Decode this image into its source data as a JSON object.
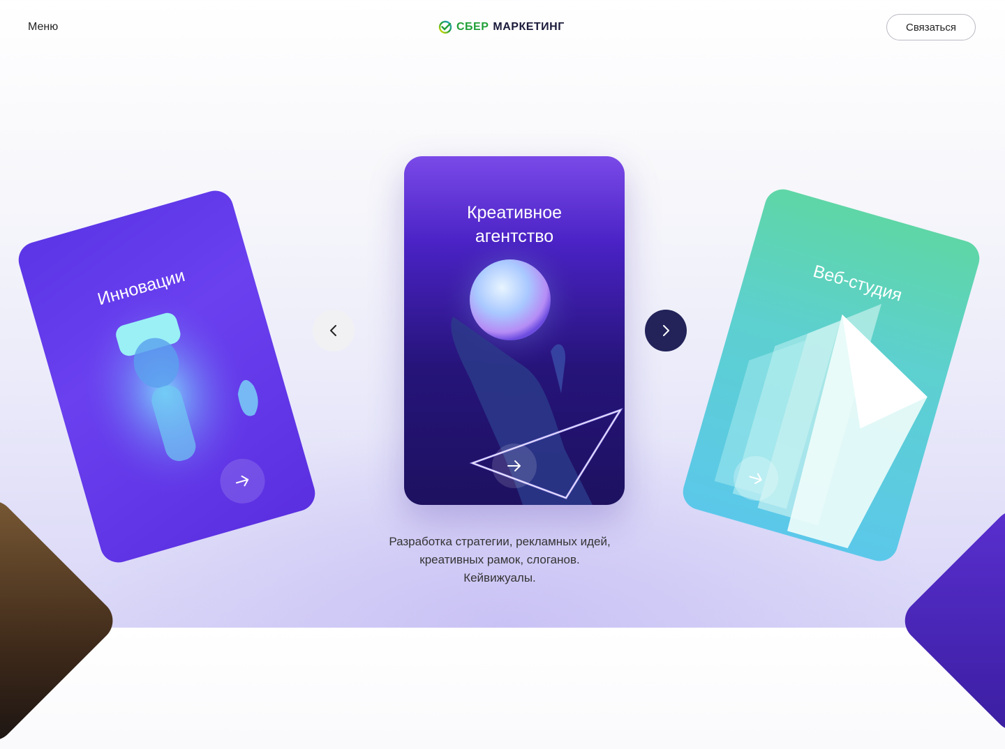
{
  "header": {
    "menu_label": "Меню",
    "logo_sber": "СБЕР",
    "logo_marketing": "МАРКЕТИНГ",
    "contact_label": "Связаться"
  },
  "cards": {
    "left": {
      "title": "Инновации"
    },
    "center": {
      "title_line1": "Креативное",
      "title_line2": "агентство"
    },
    "right": {
      "title": "Веб-студия"
    }
  },
  "description": {
    "line1": "Разработка стратегии, рекламных идей,",
    "line2": "креативных рамок, слоганов.",
    "line3": "Кейвижуалы."
  },
  "icons": {
    "prev": "chevron-left-icon",
    "next": "chevron-right-icon",
    "card_arrow": "arrow-right-icon",
    "logo": "sber-logo-icon"
  },
  "colors": {
    "brand_green": "#21a038",
    "nav_dark": "#23235a",
    "card_violet": "#5b35e6",
    "card_teal": "#5dd0cf"
  }
}
